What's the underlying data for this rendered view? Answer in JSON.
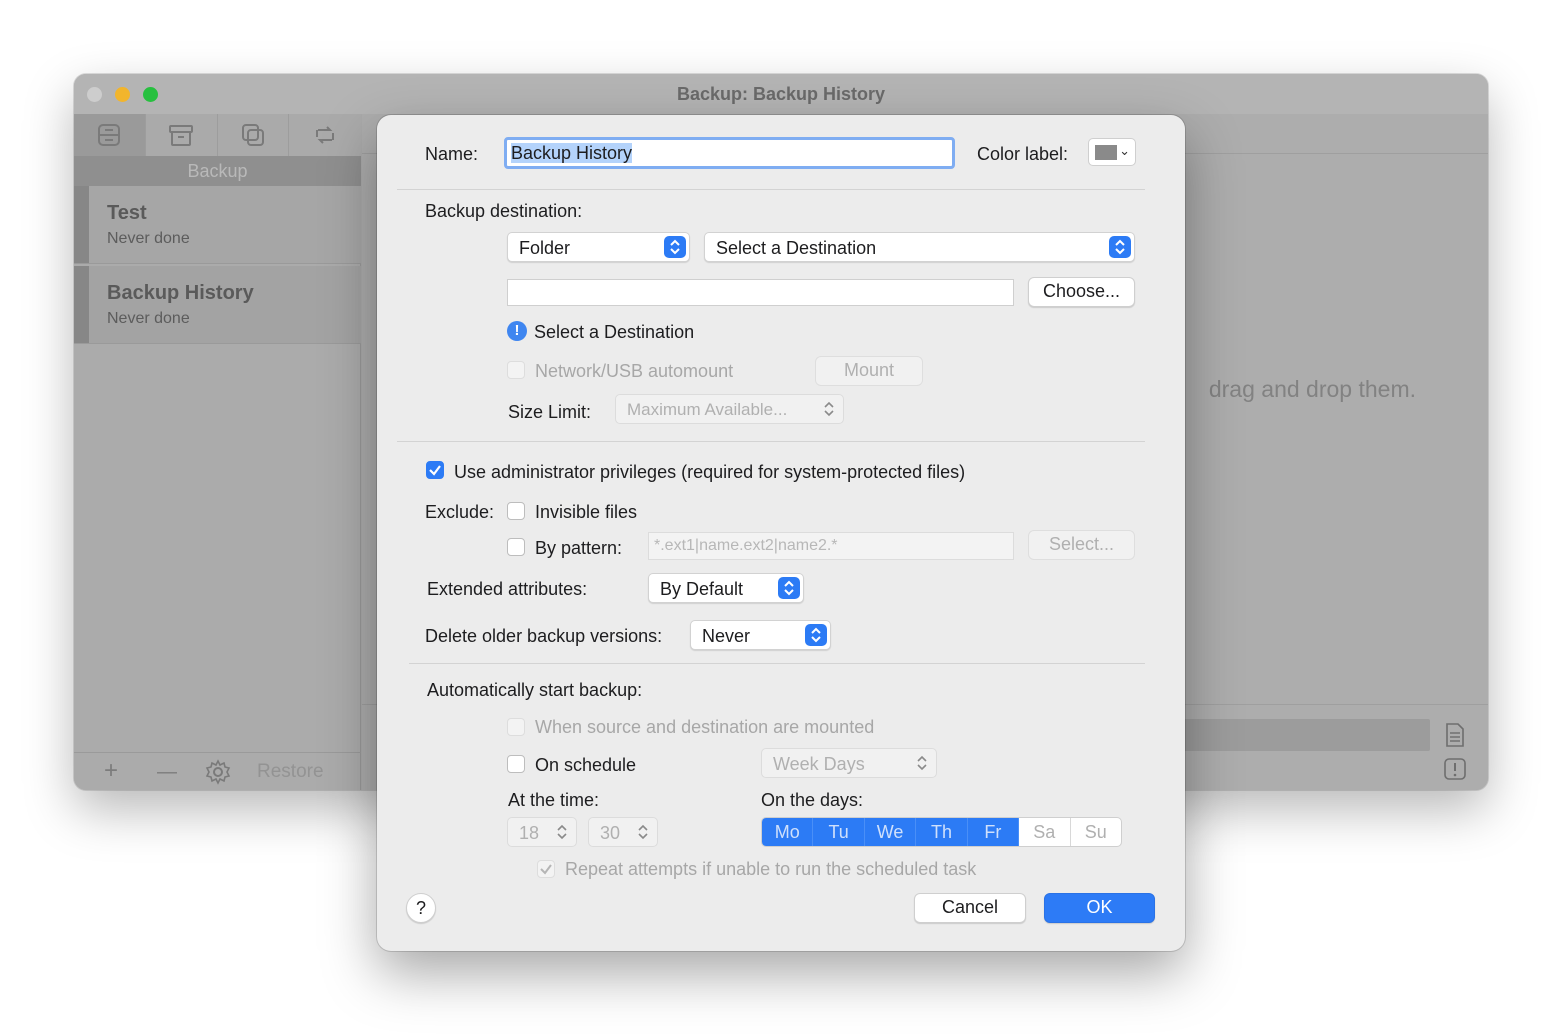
{
  "window": {
    "title": "Backup: Backup History"
  },
  "sidebar": {
    "tabs": [
      {
        "icon": "backup-tab-icon"
      },
      {
        "icon": "archive-tab-icon"
      },
      {
        "icon": "clone-tab-icon"
      },
      {
        "icon": "sync-tab-icon"
      }
    ],
    "section_label": "Backup",
    "items": [
      {
        "name": "Test",
        "status": "Never done"
      },
      {
        "name": "Backup History",
        "status": "Never done"
      }
    ],
    "footer": {
      "add": "+",
      "remove": "—",
      "restore_label": "Restore"
    }
  },
  "content": {
    "drop_hint": "drag and drop them."
  },
  "dialog": {
    "name_label": "Name:",
    "name_value": "Backup History",
    "color_label": "Color label:",
    "color_value": "#8a8a8a",
    "destination": {
      "label": "Backup destination:",
      "type_value": "Folder",
      "destination_value": "Select a Destination",
      "path_value": "",
      "choose_label": "Choose...",
      "warning_text": "Select a Destination",
      "automount_label": "Network/USB automount",
      "mount_label": "Mount",
      "size_limit_label": "Size Limit:",
      "size_limit_value": "Maximum Available..."
    },
    "admin_privileges_label": "Use administrator privileges (required for system-protected files)",
    "exclude": {
      "label": "Exclude:",
      "invisible_label": "Invisible files",
      "pattern_label": "By pattern:",
      "pattern_placeholder": "*.ext1|name.ext2|name2.*",
      "select_label": "Select..."
    },
    "extended_attributes": {
      "label": "Extended attributes:",
      "value": "By Default"
    },
    "delete_versions": {
      "label": "Delete older backup versions:",
      "value": "Never"
    },
    "auto_start": {
      "label": "Automatically start backup:",
      "mounted_label": "When source and destination are mounted",
      "schedule_label": "On schedule",
      "schedule_value": "Week Days",
      "time_label": "At the time:",
      "hour": "18",
      "minute": "30",
      "days_label": "On the days:",
      "days": [
        {
          "label": "Mo",
          "on": true
        },
        {
          "label": "Tu",
          "on": true
        },
        {
          "label": "We",
          "on": true
        },
        {
          "label": "Th",
          "on": true
        },
        {
          "label": "Fr",
          "on": true
        },
        {
          "label": "Sa",
          "on": false
        },
        {
          "label": "Su",
          "on": false
        }
      ],
      "repeat_label": "Repeat attempts if unable to run the scheduled task"
    },
    "help_label": "?",
    "cancel_label": "Cancel",
    "ok_label": "OK"
  },
  "colors": {
    "accent": "#2c7bf5",
    "focus_ring": "#7fadf2",
    "traffic_close": "#cdcdcd",
    "traffic_min": "#f2b52c",
    "traffic_zoom": "#27c03f"
  }
}
